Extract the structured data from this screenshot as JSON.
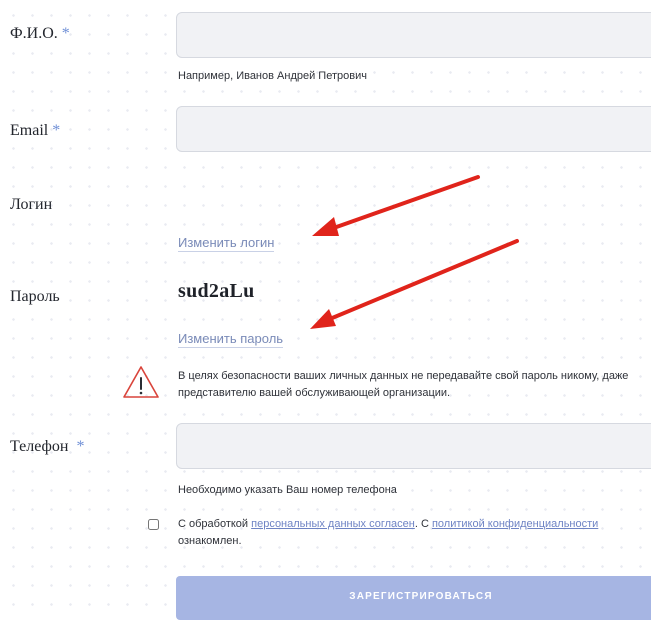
{
  "form": {
    "fio": {
      "label": "Ф.И.О.",
      "required_mark": "*",
      "value": "",
      "hint": "Например, Иванов Андрей Петрович"
    },
    "email": {
      "label": "Email",
      "required_mark": "*",
      "value": ""
    },
    "login": {
      "label": "Логин",
      "change_link": "Изменить логин"
    },
    "password": {
      "label": "Пароль",
      "value": "sud2aLu",
      "change_link": "Изменить пароль"
    },
    "security_warning": {
      "icon": "warning-triangle-icon",
      "text": "В целях безопасности ваших личных данных не передавайте свой пароль никому, даже представителю вашей обслуживающей организации."
    },
    "phone": {
      "label": "Телефон",
      "required_mark": "*",
      "value": "",
      "hint": "Необходимо указать Ваш номер телефона"
    },
    "consent": {
      "checked": false,
      "text_1": "С обработкой ",
      "link_personal_data": "персональных данных согласен",
      "text_2": ". С ",
      "link_privacy_policy": "политикой конфиденциальности",
      "text_3": " ознакомлен."
    },
    "submit_label": "ЗАРЕГИСТРИРОВАТЬСЯ"
  },
  "colors": {
    "accent": "#6f8fd6",
    "link": "#7a8bb8",
    "button": "#a6b5e3",
    "warning": "#d9443b",
    "annotation_arrow": "#e0241b",
    "input_background": "#f1f2f5"
  },
  "annotation_arrows": {
    "count": 2,
    "color": "#e0241b"
  }
}
